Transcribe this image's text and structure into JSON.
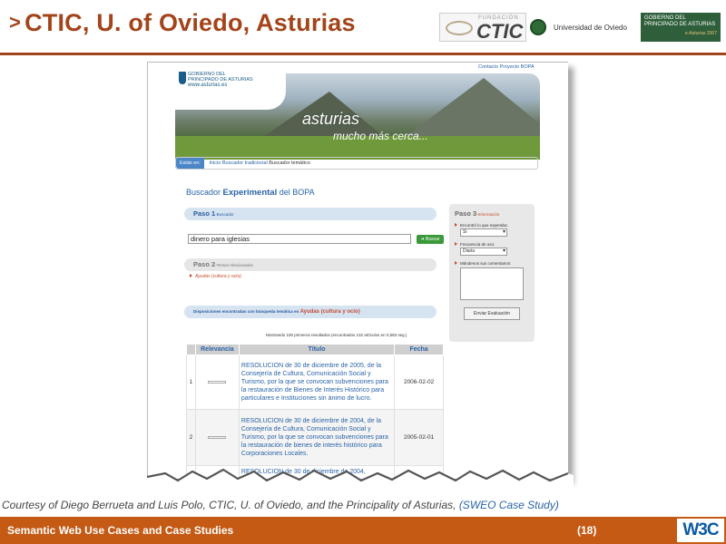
{
  "slide": {
    "arrow": ">",
    "title": "CTIC, U. of Oviedo, Asturias",
    "logos": {
      "fundacion": "FUNDACIÓN",
      "ctic": "CTIC",
      "universidad": "Universidad de Oviedo",
      "gobierno": "GOBIERNO DEL PRINCIPADO DE ASTURIAS",
      "gobierno_sub": "e-Asturias 2007"
    },
    "credit": "Courtesy of Diego Berrueta and Luis Polo, CTIC, U. of Oviedo, and the Principality of Asturias,",
    "credit_link": "(SWEO Case Study)",
    "footer_title": "Semantic Web Use Cases and Case Studies",
    "page_number": "(18)",
    "w3c": "W3C"
  },
  "site": {
    "contact": "Contacto Proyecto BOPA",
    "gob_logo_line1": "GOBIERNO DEL",
    "gob_logo_line2": "PRINCIPADO DE ASTURIAS",
    "gob_logo_url": "www.asturias.es",
    "banner_title": "asturias",
    "banner_subtitle": "mucho más cerca...",
    "breadcrumb": {
      "label": "Estás en:",
      "inicio": "Inicio",
      "tradicional": "Buscador tradicional",
      "tematico": "Buscador temático"
    },
    "title_pre": "Buscador",
    "title_bold": "Experimental",
    "title_post": "del BOPA",
    "paso1": "Paso 1",
    "paso1_sub": "-Buscador",
    "search_value": "dinero para iglesias",
    "search_button": "Buscar",
    "paso2": "Paso 2",
    "paso2_sub": "-Temas relacionados",
    "related_item": "Ayudas (cultura y ocio)",
    "disp_text": "Disposiciones encontradas con búsqueda temática en",
    "disp_topic": "Ayudas (cultura y ocio)",
    "results_info": "Mostrando 100 primeros resultados (encontrados 132 artículos en 0,583 seg.)",
    "paso3": "Paso 3",
    "paso3_sub": "-Información",
    "q1": "Encontró lo que esperaba:",
    "q1_value": "Si",
    "q2": "Frecuencia de uso:",
    "q2_value": "Diaria",
    "q3": "Mándenos sus comentarios:",
    "eval_button": "Enviar Evaluación",
    "table": {
      "headers": [
        "Relevancia",
        "Título",
        "Fecha"
      ],
      "rows": [
        {
          "n": "1",
          "title": "RESOLUCION de 30 de diciembre de 2005, de la Consejería de Cultura, Comunicación Social y Turismo, por la que se convocan subvenciones para la restauración de Bienes de Interés Histórico para particulares e Instituciones sin ánimo de lucro.",
          "date": "2006-02-02"
        },
        {
          "n": "2",
          "title": "RESOLUCION de 30 de diciembre de 2004, de la Consejería de Cultura, Comunicación Social y Turismo, por la que se convocan subvenciones para la restauración de bienes de interés histórico para Corporaciones Locales.",
          "date": "2005-02-01"
        },
        {
          "n": "",
          "title": "RESOLUCION de 30 de diciembre de 2004,",
          "date": ""
        }
      ]
    }
  }
}
